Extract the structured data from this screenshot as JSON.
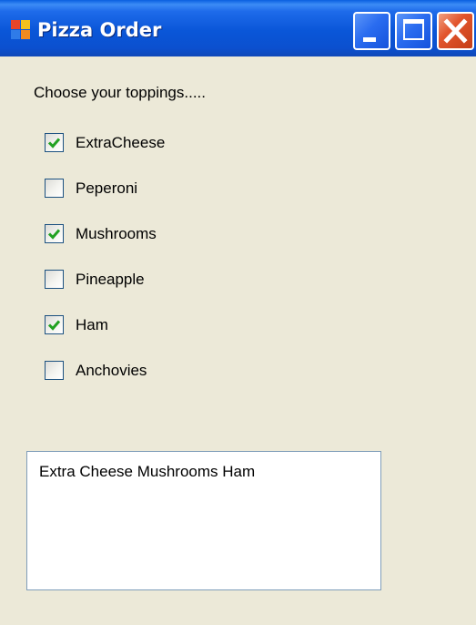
{
  "window": {
    "title": "Pizza Order",
    "controls": {
      "minimize": "minimize-icon",
      "maximize": "maximize-icon",
      "close": "close-icon"
    }
  },
  "form": {
    "prompt": "Choose your toppings.....",
    "toppings": [
      {
        "label": "ExtraCheese",
        "checked": true
      },
      {
        "label": "Peperoni",
        "checked": false
      },
      {
        "label": "Mushrooms",
        "checked": true
      },
      {
        "label": "Pineapple",
        "checked": false
      },
      {
        "label": "Ham",
        "checked": true
      },
      {
        "label": "Anchovies",
        "checked": false
      }
    ],
    "summary_text": "Extra Cheese Mushrooms Ham"
  },
  "colors": {
    "titlebar": "#0A56D8",
    "background": "#ECE9D8",
    "checkmark": "#21A121",
    "checkbox_border": "#1C5180",
    "textbox_border": "#7F9DB9"
  }
}
